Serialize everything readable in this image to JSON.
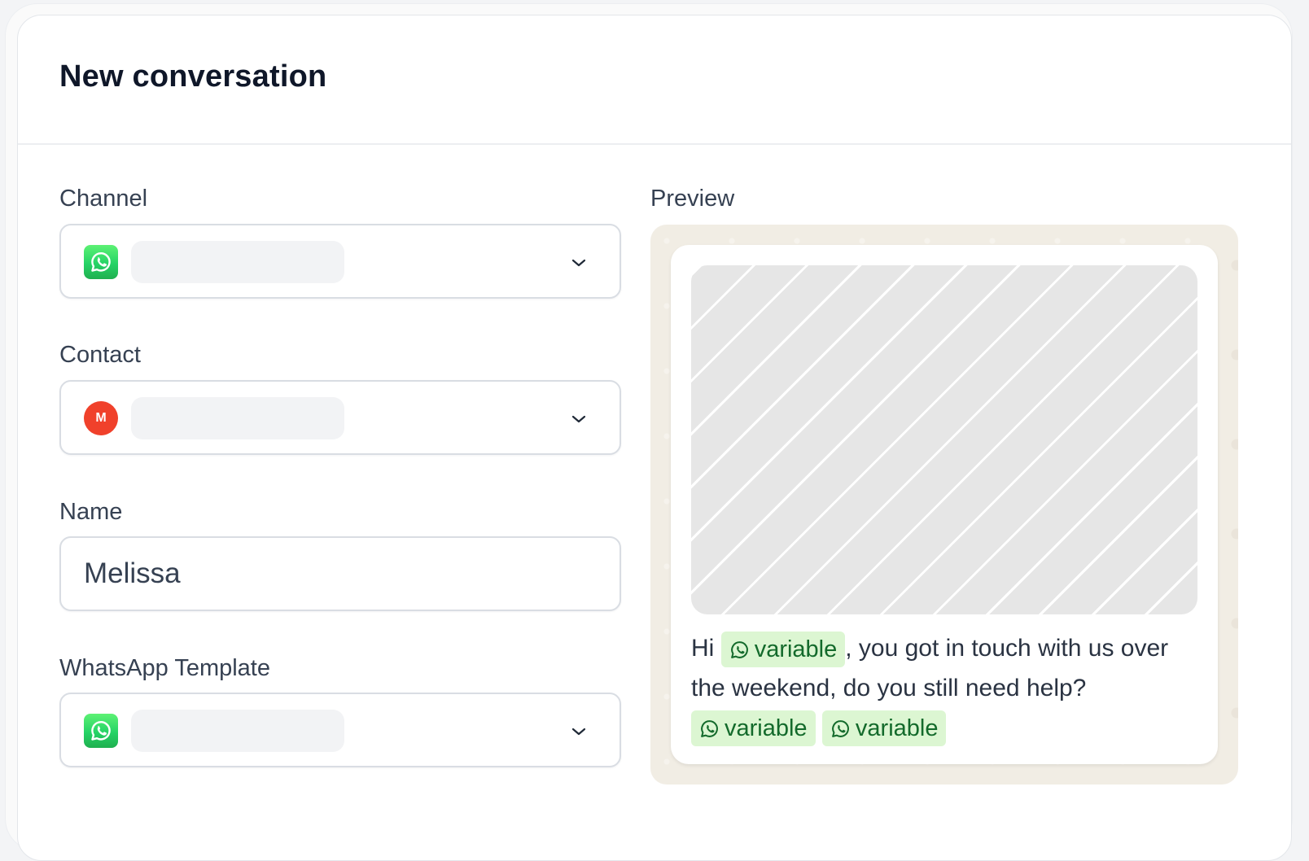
{
  "page": {
    "title": "New conversation"
  },
  "form": {
    "channel_label": "Channel",
    "contact_label": "Contact",
    "contact_avatar_initial": "M",
    "name_label": "Name",
    "name_value": "Melissa",
    "template_label": "WhatsApp Template"
  },
  "preview": {
    "label": "Preview",
    "message_prefix": "Hi",
    "message_middle": ", you got in touch with us over the weekend, do you still need help?",
    "variable_chip_1": "variable",
    "variable_chip_2": "variable",
    "variable_chip_3": "variable"
  },
  "icons": {
    "channel": "whatsapp-icon",
    "template": "whatsapp-icon",
    "dropdown": "chevron-down-icon",
    "chip": "whatsapp-outline-icon"
  },
  "colors": {
    "whatsapp_green": "#25d366",
    "avatar_red": "#f0412b",
    "chip_bg": "#dcf6d2",
    "chip_text": "#136a2b",
    "preview_bg": "#f1ede4"
  }
}
